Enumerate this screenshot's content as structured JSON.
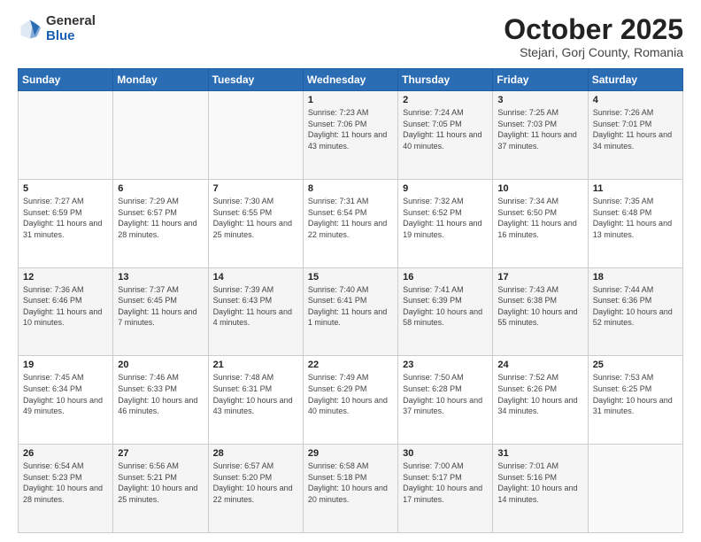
{
  "logo": {
    "general": "General",
    "blue": "Blue"
  },
  "title": {
    "month": "October 2025",
    "location": "Stejari, Gorj County, Romania"
  },
  "days_header": [
    "Sunday",
    "Monday",
    "Tuesday",
    "Wednesday",
    "Thursday",
    "Friday",
    "Saturday"
  ],
  "weeks": [
    [
      {
        "day": "",
        "content": ""
      },
      {
        "day": "",
        "content": ""
      },
      {
        "day": "",
        "content": ""
      },
      {
        "day": "1",
        "content": "Sunrise: 7:23 AM\nSunset: 7:06 PM\nDaylight: 11 hours and 43 minutes."
      },
      {
        "day": "2",
        "content": "Sunrise: 7:24 AM\nSunset: 7:05 PM\nDaylight: 11 hours and 40 minutes."
      },
      {
        "day": "3",
        "content": "Sunrise: 7:25 AM\nSunset: 7:03 PM\nDaylight: 11 hours and 37 minutes."
      },
      {
        "day": "4",
        "content": "Sunrise: 7:26 AM\nSunset: 7:01 PM\nDaylight: 11 hours and 34 minutes."
      }
    ],
    [
      {
        "day": "5",
        "content": "Sunrise: 7:27 AM\nSunset: 6:59 PM\nDaylight: 11 hours and 31 minutes."
      },
      {
        "day": "6",
        "content": "Sunrise: 7:29 AM\nSunset: 6:57 PM\nDaylight: 11 hours and 28 minutes."
      },
      {
        "day": "7",
        "content": "Sunrise: 7:30 AM\nSunset: 6:55 PM\nDaylight: 11 hours and 25 minutes."
      },
      {
        "day": "8",
        "content": "Sunrise: 7:31 AM\nSunset: 6:54 PM\nDaylight: 11 hours and 22 minutes."
      },
      {
        "day": "9",
        "content": "Sunrise: 7:32 AM\nSunset: 6:52 PM\nDaylight: 11 hours and 19 minutes."
      },
      {
        "day": "10",
        "content": "Sunrise: 7:34 AM\nSunset: 6:50 PM\nDaylight: 11 hours and 16 minutes."
      },
      {
        "day": "11",
        "content": "Sunrise: 7:35 AM\nSunset: 6:48 PM\nDaylight: 11 hours and 13 minutes."
      }
    ],
    [
      {
        "day": "12",
        "content": "Sunrise: 7:36 AM\nSunset: 6:46 PM\nDaylight: 11 hours and 10 minutes."
      },
      {
        "day": "13",
        "content": "Sunrise: 7:37 AM\nSunset: 6:45 PM\nDaylight: 11 hours and 7 minutes."
      },
      {
        "day": "14",
        "content": "Sunrise: 7:39 AM\nSunset: 6:43 PM\nDaylight: 11 hours and 4 minutes."
      },
      {
        "day": "15",
        "content": "Sunrise: 7:40 AM\nSunset: 6:41 PM\nDaylight: 11 hours and 1 minute."
      },
      {
        "day": "16",
        "content": "Sunrise: 7:41 AM\nSunset: 6:39 PM\nDaylight: 10 hours and 58 minutes."
      },
      {
        "day": "17",
        "content": "Sunrise: 7:43 AM\nSunset: 6:38 PM\nDaylight: 10 hours and 55 minutes."
      },
      {
        "day": "18",
        "content": "Sunrise: 7:44 AM\nSunset: 6:36 PM\nDaylight: 10 hours and 52 minutes."
      }
    ],
    [
      {
        "day": "19",
        "content": "Sunrise: 7:45 AM\nSunset: 6:34 PM\nDaylight: 10 hours and 49 minutes."
      },
      {
        "day": "20",
        "content": "Sunrise: 7:46 AM\nSunset: 6:33 PM\nDaylight: 10 hours and 46 minutes."
      },
      {
        "day": "21",
        "content": "Sunrise: 7:48 AM\nSunset: 6:31 PM\nDaylight: 10 hours and 43 minutes."
      },
      {
        "day": "22",
        "content": "Sunrise: 7:49 AM\nSunset: 6:29 PM\nDaylight: 10 hours and 40 minutes."
      },
      {
        "day": "23",
        "content": "Sunrise: 7:50 AM\nSunset: 6:28 PM\nDaylight: 10 hours and 37 minutes."
      },
      {
        "day": "24",
        "content": "Sunrise: 7:52 AM\nSunset: 6:26 PM\nDaylight: 10 hours and 34 minutes."
      },
      {
        "day": "25",
        "content": "Sunrise: 7:53 AM\nSunset: 6:25 PM\nDaylight: 10 hours and 31 minutes."
      }
    ],
    [
      {
        "day": "26",
        "content": "Sunrise: 6:54 AM\nSunset: 5:23 PM\nDaylight: 10 hours and 28 minutes."
      },
      {
        "day": "27",
        "content": "Sunrise: 6:56 AM\nSunset: 5:21 PM\nDaylight: 10 hours and 25 minutes."
      },
      {
        "day": "28",
        "content": "Sunrise: 6:57 AM\nSunset: 5:20 PM\nDaylight: 10 hours and 22 minutes."
      },
      {
        "day": "29",
        "content": "Sunrise: 6:58 AM\nSunset: 5:18 PM\nDaylight: 10 hours and 20 minutes."
      },
      {
        "day": "30",
        "content": "Sunrise: 7:00 AM\nSunset: 5:17 PM\nDaylight: 10 hours and 17 minutes."
      },
      {
        "day": "31",
        "content": "Sunrise: 7:01 AM\nSunset: 5:16 PM\nDaylight: 10 hours and 14 minutes."
      },
      {
        "day": "",
        "content": ""
      }
    ]
  ]
}
